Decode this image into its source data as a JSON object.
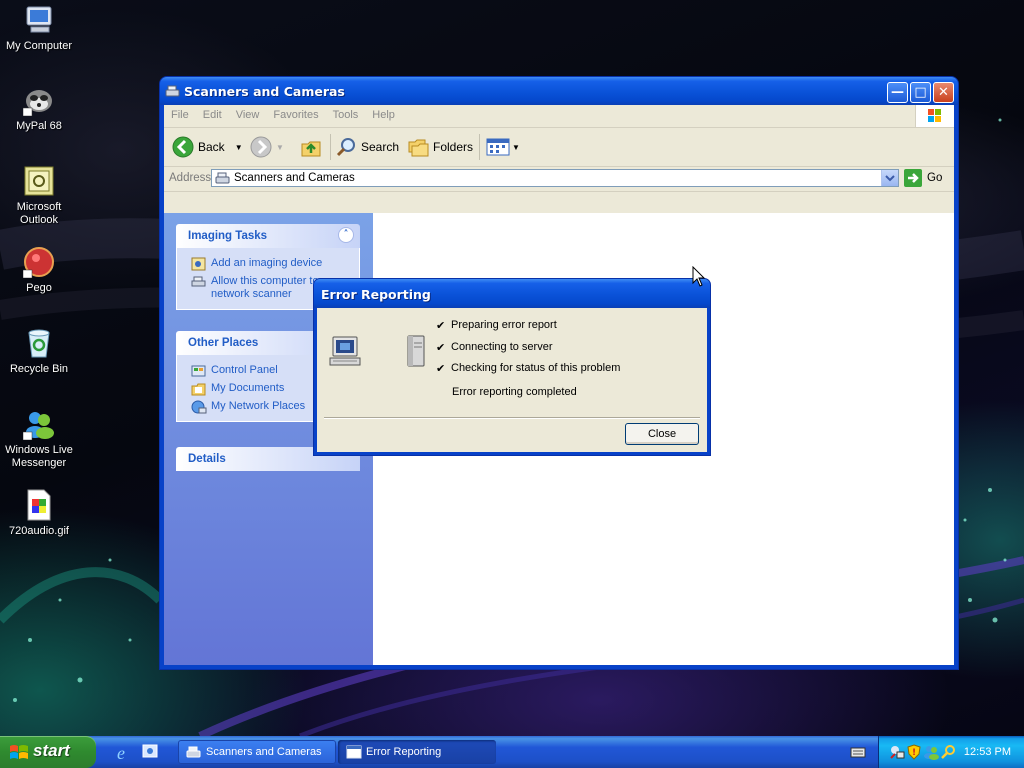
{
  "desktop": {
    "icons": [
      {
        "label": "My Computer",
        "icon": "my-computer-icon"
      },
      {
        "label": "MyPal 68",
        "icon": "mypal-icon"
      },
      {
        "label": "Microsoft Outlook",
        "icon": "outlook-icon"
      },
      {
        "label": "Pego",
        "icon": "pego-icon"
      },
      {
        "label": "Recycle Bin",
        "icon": "recycle-bin-icon"
      },
      {
        "label": "Windows Live Messenger",
        "icon": "messenger-icon"
      },
      {
        "label": "720audio.gif",
        "icon": "gif-file-icon"
      }
    ]
  },
  "explorer": {
    "title": "Scanners and Cameras",
    "menu": [
      "File",
      "Edit",
      "View",
      "Favorites",
      "Tools",
      "Help"
    ],
    "toolbar": {
      "back": "Back",
      "search": "Search",
      "folders": "Folders"
    },
    "address": {
      "label": "Address",
      "value": "Scanners and Cameras",
      "go": "Go"
    },
    "panels": {
      "imaging_tasks": {
        "title": "Imaging Tasks",
        "items": [
          "Add an imaging device",
          "Allow this computer to use a network scanner"
        ]
      },
      "other_places": {
        "title": "Other Places",
        "items": [
          "Control Panel",
          "My Documents",
          "My Network Places"
        ]
      },
      "details": {
        "title": "Details"
      }
    }
  },
  "dialog": {
    "title": "Error Reporting",
    "steps": [
      "Preparing error report",
      "Connecting to server",
      "Checking for status of this problem"
    ],
    "status": "Error reporting completed",
    "close": "Close"
  },
  "taskbar": {
    "start": "start",
    "tasks": [
      "Scanners and Cameras",
      "Error Reporting"
    ],
    "clock": "12:53 PM"
  },
  "colors": {
    "xp_blue": "#0842c8",
    "link_blue": "#215dc6",
    "start_green": "#2f8a2f",
    "dialog_face": "#ece9d8"
  }
}
